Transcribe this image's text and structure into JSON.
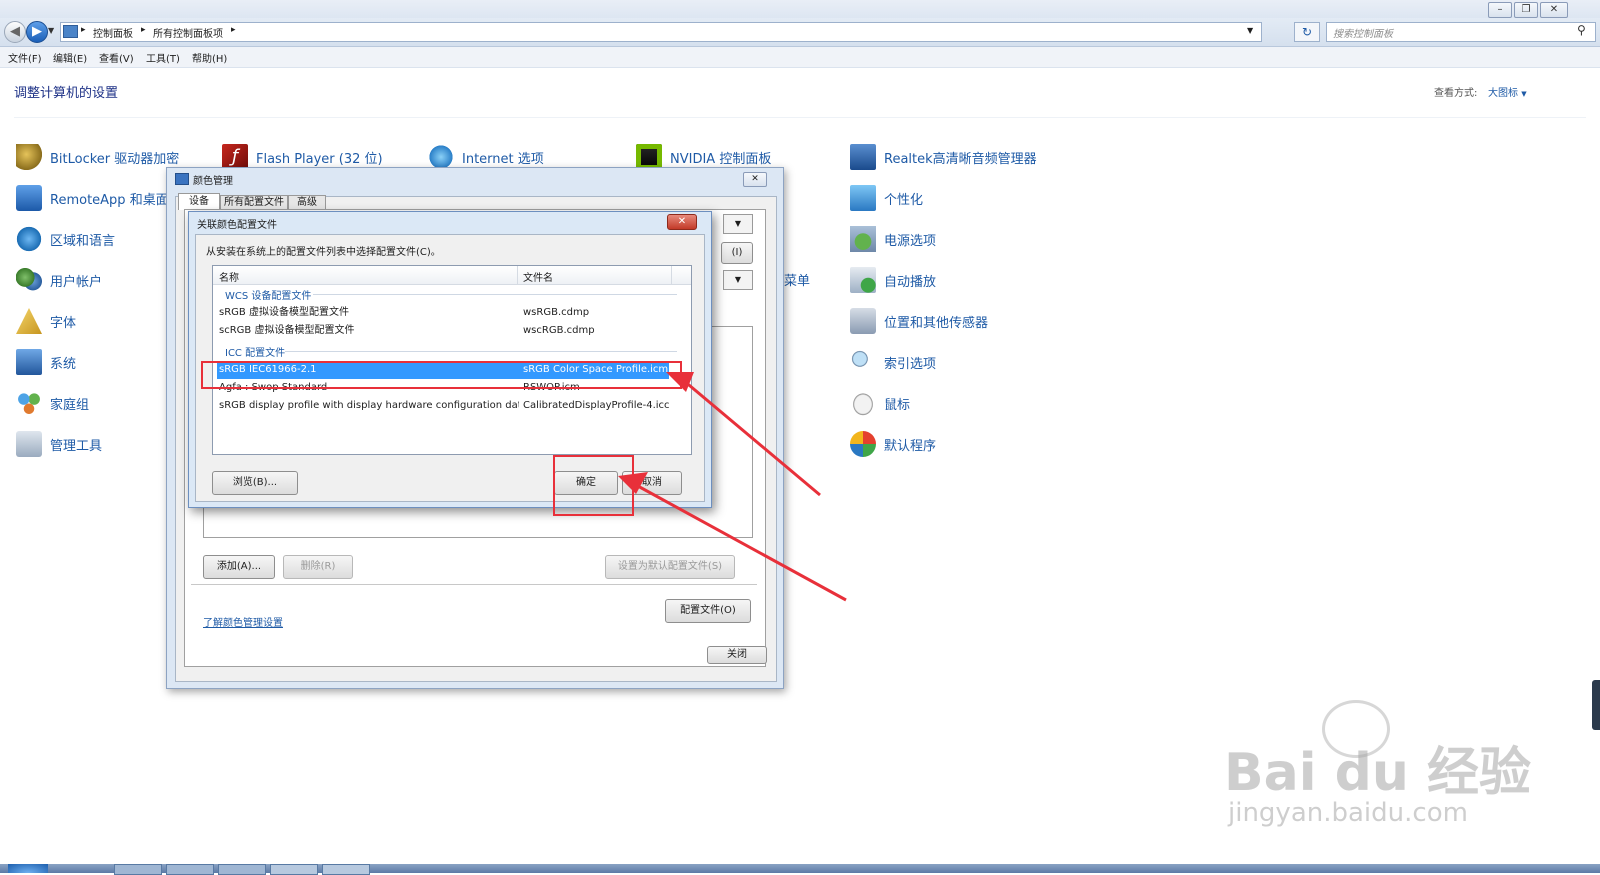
{
  "addressbar": {
    "crumb1": "控制面板",
    "crumb2": "所有控制面板项",
    "search_placeholder": "搜索控制面板"
  },
  "menu": [
    "文件(F)",
    "编辑(E)",
    "查看(V)",
    "工具(T)",
    "帮助(H)"
  ],
  "page": {
    "title": "调整计算机的设置",
    "view_by_label": "查看方式:",
    "view_by_value": "大图标"
  },
  "control_panel_items": {
    "col1": [
      "BitLocker 驱动器加密",
      "RemoteApp 和桌面",
      "区域和语言",
      "用户帐户",
      "字体",
      "系统",
      "家庭组",
      "管理工具"
    ],
    "col2": [
      "Flash Player (32 位)"
    ],
    "col3": [
      "Internet 选项"
    ],
    "col4": [
      "NVIDIA 控制面板",
      "菜单"
    ],
    "col5": [
      "Realtek高清晰音频管理器",
      "个性化",
      "电源选项",
      "自动播放",
      "位置和其他传感器",
      "索引选项",
      "鼠标",
      "默认程序"
    ]
  },
  "color_mgmt": {
    "title": "颜色管理",
    "tabs": [
      "设备",
      "所有配置文件",
      "高级"
    ],
    "partial_button": "(I)",
    "add_button": "添加(A)...",
    "remove_button": "删除(R)",
    "set_default_button": "设置为默认配置文件(S)",
    "learn_link": "了解颜色管理设置",
    "profiles_button": "配置文件(O)",
    "close_button": "关闭"
  },
  "dialog": {
    "title": "关联颜色配置文件",
    "instruction": "从安装在系统上的配置文件列表中选择配置文件(C)。",
    "columns": [
      "名称",
      "文件名"
    ],
    "groups": [
      {
        "label": "WCS 设备配置文件",
        "rows": [
          {
            "name": "sRGB 虚拟设备模型配置文件",
            "file": "wsRGB.cdmp"
          },
          {
            "name": "scRGB 虚拟设备模型配置文件",
            "file": "wscRGB.cdmp"
          }
        ]
      },
      {
        "label": "ICC 配置文件",
        "rows": [
          {
            "name": "sRGB IEC61966-2.1",
            "file": "sRGB Color Space Profile.icm",
            "selected": true
          },
          {
            "name": "Agfa : Swop Standard",
            "file": "RSWOP.icm"
          },
          {
            "name": "sRGB display profile with display hardware configuration dat...",
            "file": "CalibratedDisplayProfile-4.icc"
          }
        ]
      }
    ],
    "browse_button": "浏览(B)...",
    "ok_button": "确定",
    "cancel_button": "取消"
  },
  "watermark": {
    "brand": "Bai du 经验",
    "url": "jingyan.baidu.com"
  },
  "colors": {
    "accent": "#1e5aa6",
    "selection": "#3399ff",
    "annotation": "#e8303a"
  }
}
